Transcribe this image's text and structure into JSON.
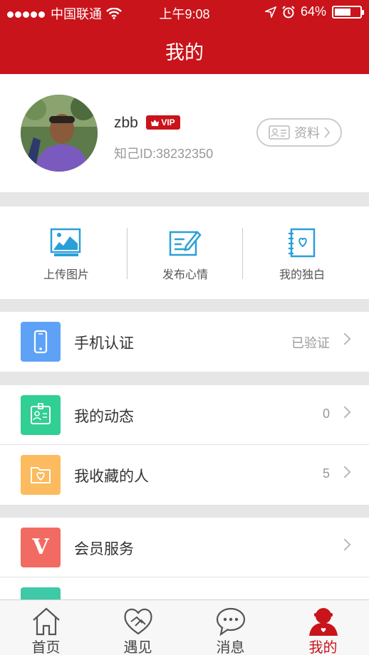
{
  "status_bar": {
    "carrier": "中国联通",
    "time": "上午9:08",
    "battery": "64%",
    "battery_level": 0.64
  },
  "header": {
    "title": "我的"
  },
  "profile": {
    "username": "zbb",
    "vip_badge": "VIP",
    "user_id": "知己ID:38232350",
    "profile_button": "资料"
  },
  "actions": [
    {
      "label": "上传图片",
      "icon": "upload-image-icon"
    },
    {
      "label": "发布心情",
      "icon": "post-mood-icon"
    },
    {
      "label": "我的独白",
      "icon": "monologue-icon"
    }
  ],
  "menu": {
    "phone_verify": {
      "label": "手机认证",
      "value": "已验证",
      "color": "#5ea2f7"
    },
    "my_updates": {
      "label": "我的动态",
      "value": "0",
      "color": "#31cf93"
    },
    "my_favorites": {
      "label": "我收藏的人",
      "value": "5",
      "color": "#fbbb5e"
    },
    "vip_service": {
      "label": "会员服务",
      "value": "",
      "color": "#f26b63",
      "icon_letter": "V"
    },
    "partial_row_color": "#3ec9a7"
  },
  "tabs": [
    {
      "label": "首页",
      "icon": "home-icon"
    },
    {
      "label": "遇见",
      "icon": "heart-hands-icon"
    },
    {
      "label": "消息",
      "icon": "chat-bubble-icon"
    },
    {
      "label": "我的",
      "icon": "user-icon",
      "active": true
    }
  ],
  "colors": {
    "brand_red": "#c9141b",
    "icon_blue": "#2a9fd8"
  }
}
